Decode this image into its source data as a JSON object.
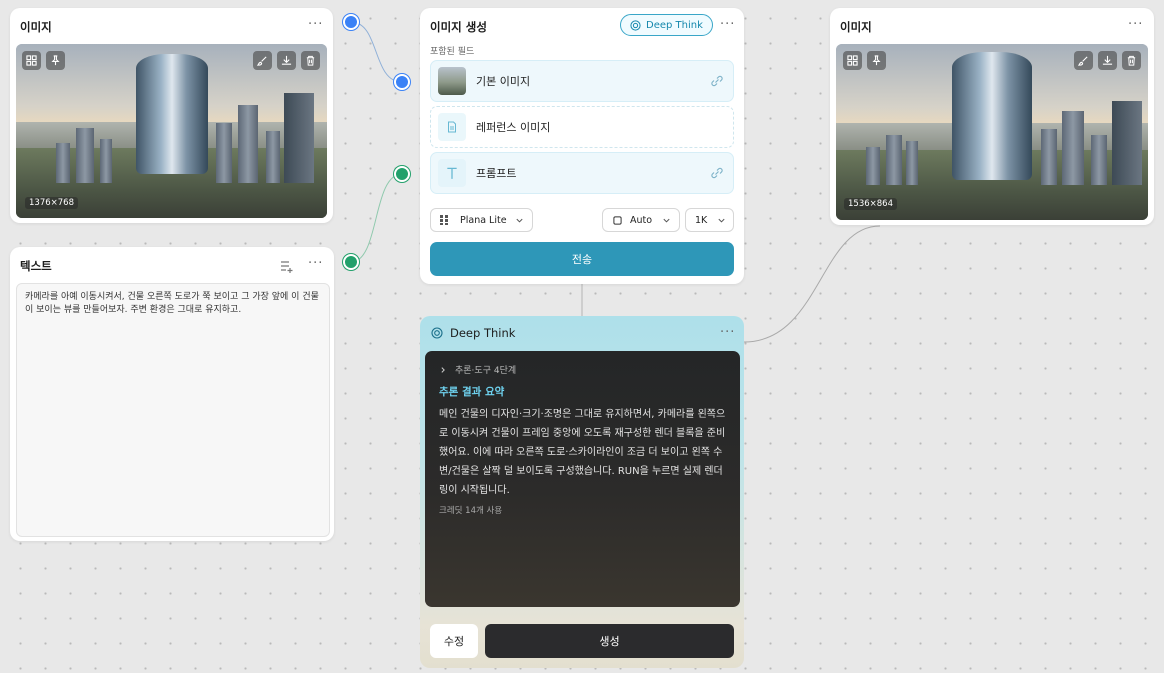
{
  "image_node_left": {
    "title": "이미지",
    "dimensions": "1376×768"
  },
  "text_node": {
    "title": "텍스트",
    "content": "카메라를 아예 이동시켜서, 건물 오른쪽 도로가 쭉 보이고 그 가장 앞에 이 건물이 보이는 뷰를 만들어보자. 주변 환경은 그대로 유지하고."
  },
  "generate_node": {
    "title": "이미지 생성",
    "badge": "Deep Think",
    "section_label": "포함된 필드",
    "fields": [
      {
        "label": "기본 이미지"
      },
      {
        "label": "레퍼런스 이미지"
      },
      {
        "label": "프롬프트"
      }
    ],
    "model": "Plana Lite",
    "aspect": "Auto",
    "resolution": "1K",
    "send_label": "전송"
  },
  "deep_think_node": {
    "title": "Deep Think",
    "steps_label": "추론·도구 4단계",
    "summary_title": "추론 결과 요약",
    "summary_text": "메인 건물의 디자인·크기·조명은 그대로 유지하면서, 카메라를 왼쪽으로 이동시켜 건물이 프레임 중앙에 오도록 재구성한 렌더 블록을 준비했어요. 이에 따라 오른쪽 도로·스카이라인이 조금 더 보이고 왼쪽 수변/건물은 살짝 덜 보이도록 구성했습니다. RUN을 누르면 실제 렌더링이 시작됩니다.",
    "credits": "크레딧 14개 사용",
    "edit_label": "수정",
    "generate_label": "생성"
  },
  "image_node_right": {
    "title": "이미지",
    "dimensions": "1536×864"
  },
  "colors": {
    "accent": "#2e97b8",
    "port_blue": "#3b82f6",
    "port_green": "#22a06b",
    "summary_title": "#6fd3f0"
  }
}
